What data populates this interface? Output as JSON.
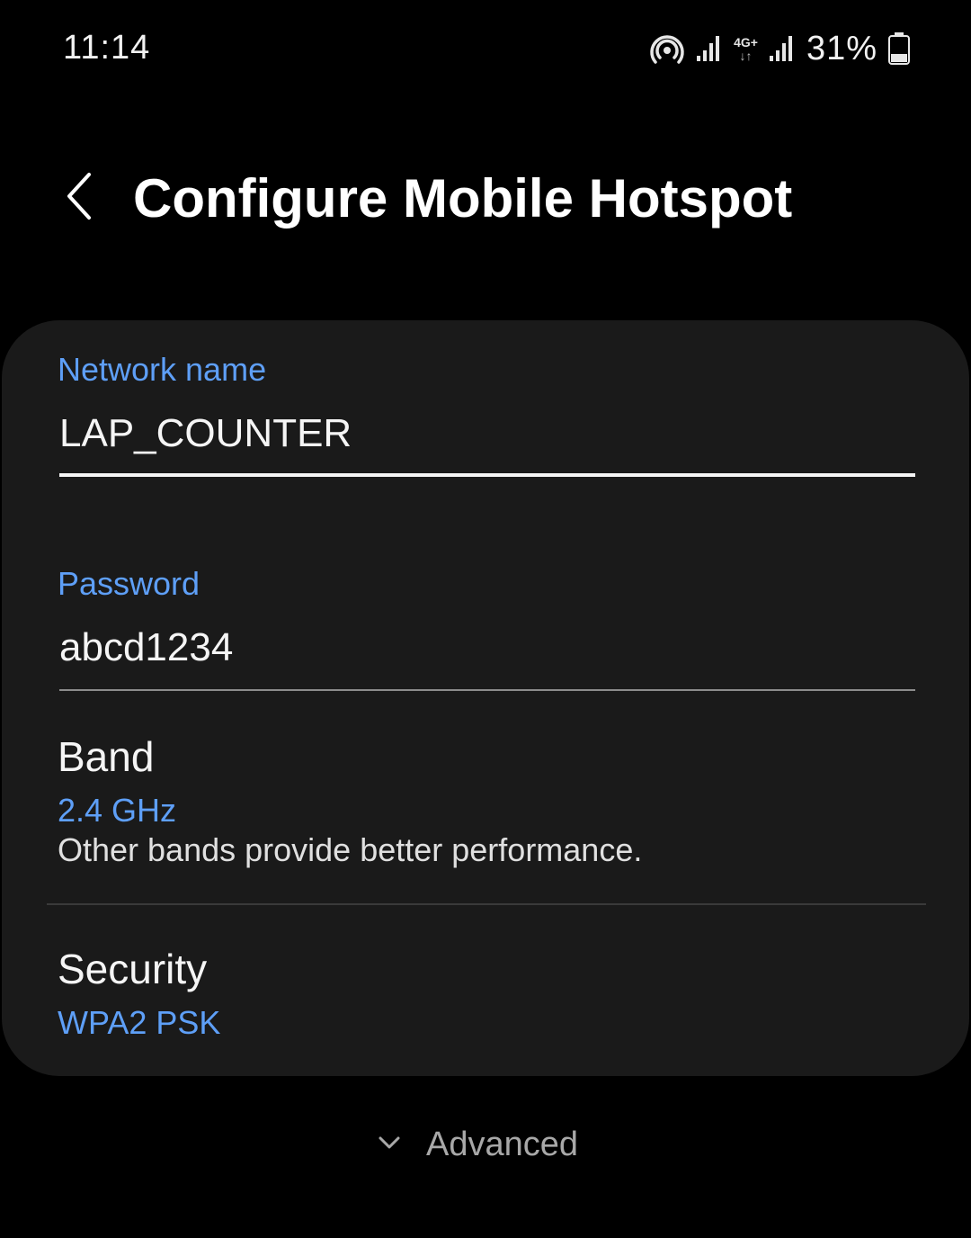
{
  "status_bar": {
    "time": "11:14",
    "network_type": "4G+",
    "network_arrows": "↓↑",
    "battery_percent": "31%",
    "icons": [
      "hotspot-icon",
      "signal-icon",
      "signal-icon",
      "battery-icon"
    ]
  },
  "header": {
    "back_icon": "chevron-left-icon",
    "title": "Configure Mobile Hotspot"
  },
  "form": {
    "network_name": {
      "label": "Network name",
      "value": "LAP_COUNTER"
    },
    "password": {
      "label": "Password",
      "value": "abcd1234"
    },
    "band": {
      "title": "Band",
      "value": "2.4 GHz",
      "description": "Other bands provide better performance."
    },
    "security": {
      "title": "Security",
      "value": "WPA2 PSK"
    }
  },
  "advanced": {
    "icon": "chevron-down-icon",
    "label": "Advanced"
  },
  "colors": {
    "background": "#000000",
    "card": "#1a1a1a",
    "accent": "#5e9ff7",
    "text": "#f5f5f5",
    "muted": "#a8a8a8"
  }
}
